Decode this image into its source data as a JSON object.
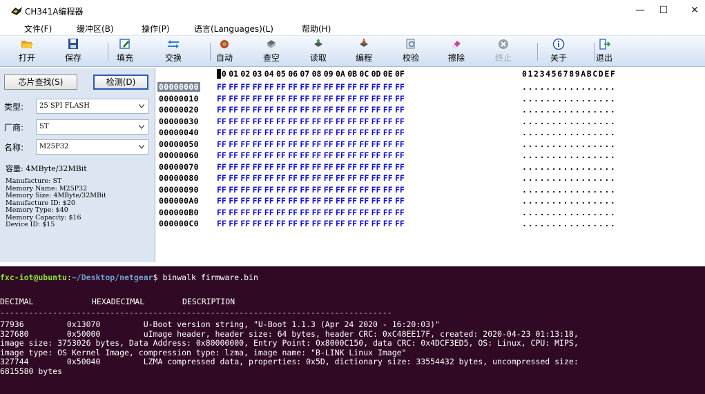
{
  "window": {
    "title": "CH341A编程器",
    "minimize": "—",
    "maximize": "☐",
    "close": "✕"
  },
  "menu": [
    "文件(F)",
    "缓冲区(B)",
    "操作(P)",
    "语言(Languages)(L)",
    "帮助(H)"
  ],
  "toolbar": [
    {
      "id": "open",
      "label": "打开",
      "icon": "folder-open-icon",
      "color": "#e0a020"
    },
    {
      "id": "save",
      "label": "保存",
      "icon": "floppy-icon",
      "color": "#2b4f9a"
    },
    {
      "id": "fill",
      "label": "填充",
      "icon": "edit-icon",
      "color": "#3a6fc0"
    },
    {
      "id": "swap",
      "label": "交换",
      "icon": "swap-arrows-icon",
      "color": "#2a7fd6"
    },
    {
      "id": "auto",
      "label": "自动",
      "icon": "auto-icon",
      "color": "#d63a2a"
    },
    {
      "id": "blank",
      "label": "查空",
      "icon": "chip-check-icon",
      "color": "#6a6a6a"
    },
    {
      "id": "read",
      "label": "读取",
      "icon": "chip-read-icon",
      "color": "#2a9a3a"
    },
    {
      "id": "program",
      "label": "编程",
      "icon": "chip-write-icon",
      "color": "#d64a1a"
    },
    {
      "id": "verify",
      "label": "校验",
      "icon": "verify-icon",
      "color": "#4a8ac0"
    },
    {
      "id": "erase",
      "label": "擦除",
      "icon": "erase-icon",
      "color": "#c04a9a"
    },
    {
      "id": "stop",
      "label": "终止",
      "icon": "stop-icon",
      "color": "#9aa0a8",
      "disabled": true
    },
    {
      "id": "about",
      "label": "关于",
      "icon": "info-icon",
      "color": "#2a5ab0"
    },
    {
      "id": "exit",
      "label": "退出",
      "icon": "exit-icon",
      "color": "#3a6ac0"
    }
  ],
  "left": {
    "find_chip_btn": "芯片查找(S)",
    "detect_btn": "检测(D)",
    "type_label": "类型:",
    "type_value": "25 SPI FLASH",
    "vendor_label": "厂商:",
    "vendor_value": "ST",
    "name_label": "名称:",
    "name_value": "M25P32",
    "capacity": "容量: 4MByte/32MBit",
    "info": [
      "Manufacture: ST",
      "Memory Name: M25P32",
      "Memory Size: 4MByte/32MBit",
      "Manufacture ID: $20",
      "Memory Type: $40",
      "Memory Capacity: $16",
      "Device ID: $15"
    ]
  },
  "hex": {
    "columns": [
      "00",
      "01",
      "02",
      "03",
      "04",
      "05",
      "06",
      "07",
      "08",
      "09",
      "0A",
      "0B",
      "0C",
      "0D",
      "0E",
      "0F"
    ],
    "ascii_header": "0123456789ABCDEF",
    "rows": [
      {
        "addr": "00000000",
        "byte": "FF",
        "ascii": "................"
      },
      {
        "addr": "00000010",
        "byte": "FF",
        "ascii": "................"
      },
      {
        "addr": "00000020",
        "byte": "FF",
        "ascii": "................"
      },
      {
        "addr": "00000030",
        "byte": "FF",
        "ascii": "................"
      },
      {
        "addr": "00000040",
        "byte": "FF",
        "ascii": "................"
      },
      {
        "addr": "00000050",
        "byte": "FF",
        "ascii": "................"
      },
      {
        "addr": "00000060",
        "byte": "FF",
        "ascii": "................"
      },
      {
        "addr": "00000070",
        "byte": "FF",
        "ascii": "................"
      },
      {
        "addr": "00000080",
        "byte": "FF",
        "ascii": "................"
      },
      {
        "addr": "00000090",
        "byte": "FF",
        "ascii": "................"
      },
      {
        "addr": "000000A0",
        "byte": "FF",
        "ascii": "................"
      },
      {
        "addr": "000000B0",
        "byte": "FF",
        "ascii": "................"
      },
      {
        "addr": "000000C0",
        "byte": "FF",
        "ascii": "................"
      }
    ]
  },
  "terminal": {
    "prompt_user": "fxc-iot@ubuntu",
    "prompt_sep": ":",
    "prompt_path": "~/Desktop/netgear",
    "prompt_end": "$ ",
    "command": "binwalk firmware.bin",
    "header_decimal": "DECIMAL",
    "header_hex": "HEXADECIMAL",
    "header_desc": "DESCRIPTION",
    "divider": "----------------------------------------------------------------------------------",
    "lines": [
      "77936         0x13070         U-Boot version string, \"U-Boot 1.1.3 (Apr 24 2020 - 16:20:03)\"",
      "327680        0x50000         uImage header, header size: 64 bytes, header CRC: 0xC48EE17F, created: 2020-04-23 01:13:18,",
      "image size: 3753026 bytes, Data Address: 0x80000000, Entry Point: 0x8000C150, data CRC: 0x4DCF3ED5, OS: Linux, CPU: MIPS,",
      "image type: OS Kernel Image, compression type: lzma, image name: \"B-LINK Linux Image\"",
      "327744        0x50040         LZMA compressed data, properties: 0x5D, dictionary size: 33554432 bytes, uncompressed size:",
      "6815580 bytes"
    ]
  }
}
